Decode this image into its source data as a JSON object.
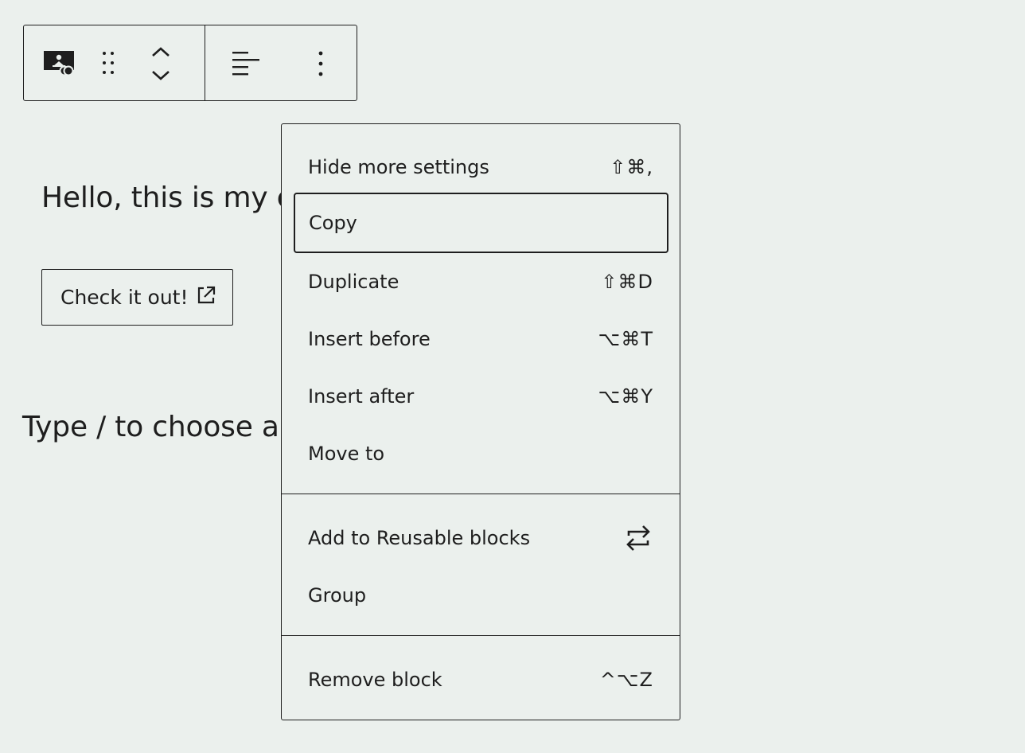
{
  "toolbar": {
    "icons": {
      "block_type": "cover-icon",
      "drag": "drag-handle-icon",
      "move_up": "chevron-up-icon",
      "move_down": "chevron-down-icon",
      "align": "align-left-icon",
      "options": "more-vertical-icon"
    }
  },
  "content": {
    "paragraph": "Hello, this is my c",
    "button_label": "Check it out!",
    "button_icon": "external-link-icon",
    "placeholder": "Type / to choose a"
  },
  "menu": {
    "items": [
      {
        "label": "Hide more settings",
        "shortcut": "⇧⌘,"
      },
      {
        "label": "Copy",
        "shortcut": ""
      },
      {
        "label": "Duplicate",
        "shortcut": "⇧⌘D"
      },
      {
        "label": "Insert before",
        "shortcut": "⌥⌘T"
      },
      {
        "label": "Insert after",
        "shortcut": "⌥⌘Y"
      },
      {
        "label": "Move to",
        "shortcut": ""
      },
      {
        "label": "Add to Reusable blocks",
        "icon": "reusable-block-icon"
      },
      {
        "label": "Group",
        "shortcut": ""
      },
      {
        "label": "Remove block",
        "shortcut": "^⌥Z"
      }
    ]
  },
  "colors": {
    "background": "#ebf0ed",
    "foreground": "#1e1e1e"
  }
}
